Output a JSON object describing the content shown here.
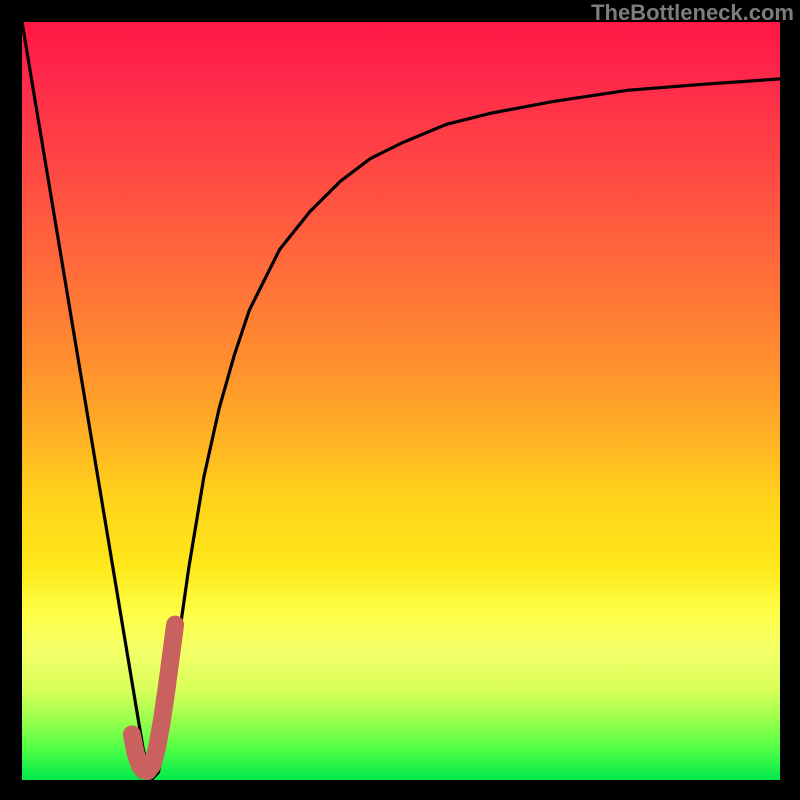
{
  "watermark": {
    "text": "TheBottleneck.com"
  },
  "colors": {
    "curve_stroke": "#000000",
    "marker_stroke": "#c9625e",
    "plot_border": "#000000"
  },
  "chart_data": {
    "type": "line",
    "title": "",
    "xlabel": "",
    "ylabel": "",
    "xlim": [
      0,
      100
    ],
    "ylim": [
      0,
      100
    ],
    "grid": false,
    "series": [
      {
        "name": "bottleneck-curve",
        "x": [
          0,
          5,
          10,
          13,
          15,
          16,
          17,
          18,
          19,
          20,
          22,
          24,
          26,
          28,
          30,
          34,
          38,
          42,
          46,
          50,
          56,
          62,
          70,
          80,
          90,
          100
        ],
        "y": [
          100,
          70,
          40,
          22,
          10,
          4,
          0,
          1,
          6,
          14,
          28,
          40,
          49,
          56,
          62,
          70,
          75,
          79,
          82,
          84,
          86.5,
          88,
          89.5,
          91,
          91.8,
          92.5
        ]
      }
    ],
    "marker": {
      "name": "J-shape-highlight",
      "x": [
        14.5,
        15,
        15.5,
        16,
        16.6,
        17.2,
        17.8,
        18.4,
        19,
        19.6,
        20.2
      ],
      "y": [
        6,
        3.5,
        2,
        1.3,
        1.2,
        2,
        4.2,
        7.5,
        11.5,
        16,
        20.5
      ]
    }
  }
}
